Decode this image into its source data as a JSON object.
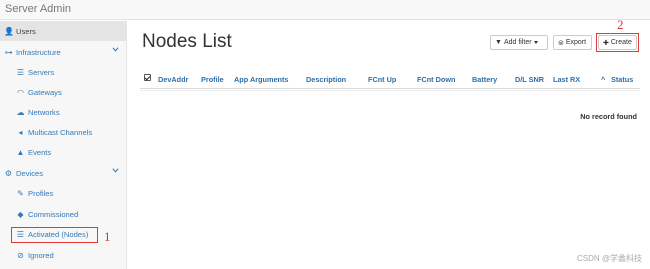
{
  "app": {
    "title": "Server Admin"
  },
  "sidebar": {
    "items": [
      {
        "label": "Users",
        "icon": "user-icon",
        "glyph": "👤",
        "kind": "top"
      },
      {
        "label": "Infrastructure",
        "icon": "sitemap-icon",
        "glyph": "⊶",
        "kind": "section",
        "expanded": true
      },
      {
        "label": "Servers",
        "icon": "server-icon",
        "glyph": "☰",
        "kind": "sub"
      },
      {
        "label": "Gateways",
        "icon": "wifi-icon",
        "glyph": "◠",
        "kind": "sub"
      },
      {
        "label": "Networks",
        "icon": "cloud-icon",
        "glyph": "☁",
        "kind": "sub"
      },
      {
        "label": "Multicast Channels",
        "icon": "bullhorn-icon",
        "glyph": "◂",
        "kind": "sub"
      },
      {
        "label": "Events",
        "icon": "warning-icon",
        "glyph": "▲",
        "kind": "sub"
      },
      {
        "label": "Devices",
        "icon": "cubes-icon",
        "glyph": "⚙",
        "kind": "section",
        "expanded": true
      },
      {
        "label": "Profiles",
        "icon": "edit-icon",
        "glyph": "✎",
        "kind": "sub"
      },
      {
        "label": "Commissioned",
        "icon": "cube-icon",
        "glyph": "◆",
        "kind": "sub"
      },
      {
        "label": "Activated (Nodes)",
        "icon": "rss-icon",
        "glyph": "☰",
        "kind": "sub"
      },
      {
        "label": "Ignored",
        "icon": "ban-icon",
        "glyph": "⊘",
        "kind": "sub"
      }
    ]
  },
  "annotations": {
    "mark1": "1",
    "mark2": "2",
    "color": "#e23a3a"
  },
  "main": {
    "title": "Nodes List",
    "buttons": {
      "filter": {
        "label": "Add filter",
        "icon": "filter-icon",
        "glyph": "▼"
      },
      "export": {
        "label": "Export",
        "icon": "download-icon",
        "glyph": "⊜"
      },
      "create": {
        "label": "Create",
        "icon": "plus-icon",
        "glyph": "✚"
      }
    },
    "columns": [
      "DevAddr",
      "Profile",
      "App Arguments",
      "Description",
      "FCnt Up",
      "FCnt Down",
      "Battery",
      "D/L SNR",
      "Last RX",
      "Status"
    ],
    "sort_glyph": "^",
    "empty_text": "No record found"
  },
  "watermark": "CSDN @学蠡科技",
  "colors": {
    "link": "#337ab7",
    "header": "#2f6fa8",
    "highlight": "#e23a3a"
  }
}
